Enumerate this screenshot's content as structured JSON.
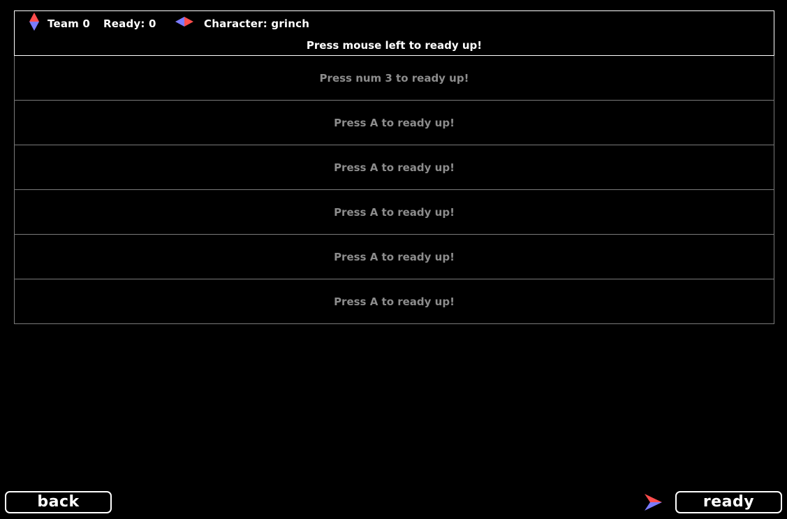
{
  "header": {
    "team_label": "Team 0",
    "ready_label": "Ready: 0",
    "character_label": "Character: grinch"
  },
  "active_slot": {
    "prompt": "Press mouse left to ready up!"
  },
  "slots": [
    {
      "prompt": "Press num 3 to ready up!"
    },
    {
      "prompt": "Press A to ready up!"
    },
    {
      "prompt": "Press A to ready up!"
    },
    {
      "prompt": "Press A to ready up!"
    },
    {
      "prompt": "Press A to ready up!"
    },
    {
      "prompt": "Press A to ready up!"
    }
  ],
  "buttons": {
    "back_label": "back",
    "ready_label": "ready"
  },
  "icons": {
    "team_toggle": "vertical-diamond-arrows-icon",
    "character_toggle": "horizontal-diamond-arrows-icon",
    "cursor": "arrow-cursor-icon"
  },
  "colors": {
    "arrow_red": "#ff4d4d",
    "arrow_blue": "#7b7bff",
    "inactive_text": "#8c8c8c",
    "inactive_border": "#7a7a7a"
  }
}
